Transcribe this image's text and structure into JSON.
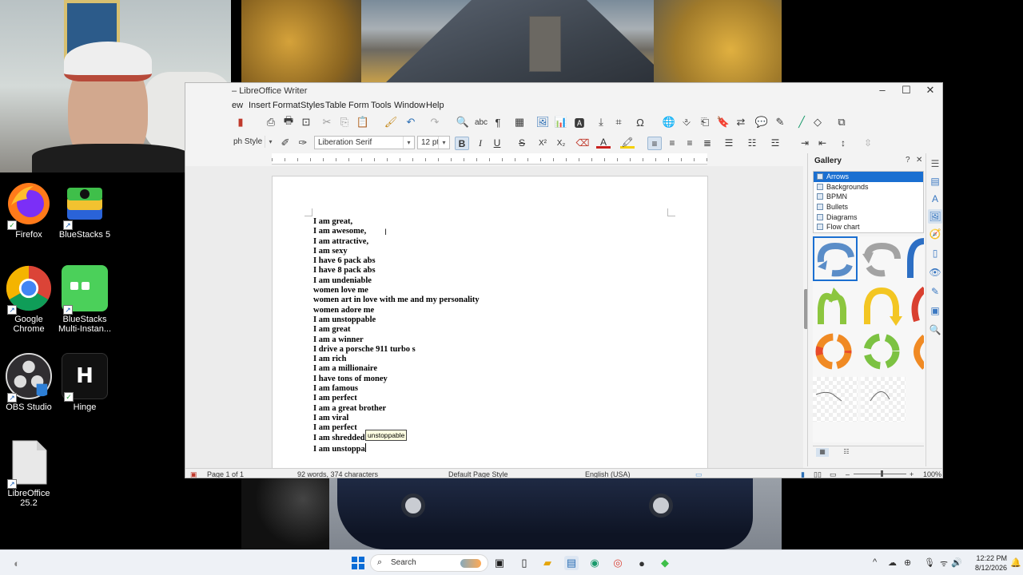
{
  "window": {
    "title": "LibreOffice Writer"
  },
  "menu": [
    "ew",
    "Insert",
    "Format",
    "Styles",
    "Table",
    "Form",
    "Tools",
    "Window",
    "Help"
  ],
  "format_bar": {
    "paragraph_style": "ph Style",
    "font_name": "Liberation Serif",
    "font_size": "12 pt"
  },
  "document": {
    "lines": [
      "I am great,",
      "I am awesome,",
      "I am attractive,",
      "I am sexy",
      "I have 6 pack abs",
      "I have 8 pack abs",
      "I am undeniable",
      "women love me",
      "women art in love with me and my personality",
      "women adore me",
      "I am unstoppable",
      "I am great",
      "I am a winner",
      "I drive a porsche 911 turbo s",
      "I am rich",
      "I am a millionaire",
      "I have tons of money",
      "I am famous",
      "I am perfect",
      "I am a great brother",
      "I am viral",
      "I am perfect",
      "I am shredded",
      "I am unstoppa"
    ],
    "autocomplete": "unstoppable"
  },
  "sidebar": {
    "title": "Gallery",
    "themes": [
      "Arrows",
      "Backgrounds",
      "BPMN",
      "Bullets",
      "Diagrams",
      "Flow chart"
    ],
    "selected_theme": "Arrows"
  },
  "status": {
    "page": "Page 1 of 1",
    "words": "92 words, 374 characters",
    "page_style": "Default Page Style",
    "language": "English (USA)",
    "zoom": "100%"
  },
  "desktop_icons": [
    "Firefox",
    "BlueStacks 5",
    "Google Chrome",
    "BlueStacks Multi-Instan...",
    "OBS Studio",
    "Hinge",
    "LibreOffice 25.2"
  ],
  "taskbar": {
    "search_placeholder": "Search",
    "time": "12:22 PM",
    "date": "8/12/2026"
  }
}
